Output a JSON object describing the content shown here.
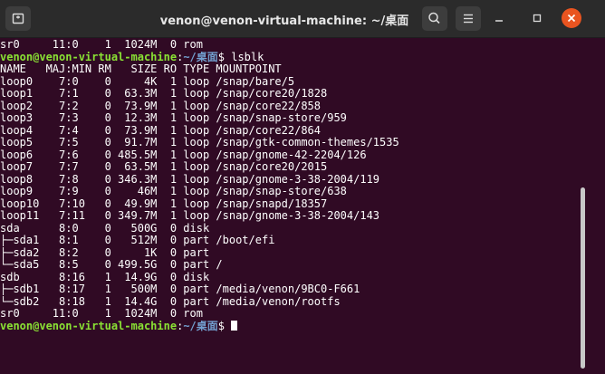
{
  "window": {
    "title": "venon@venon-virtual-machine: ~/桌面"
  },
  "colors": {
    "background": "#300a24",
    "titlebar": "#2b2b2b",
    "prompt_user": "#8ae234",
    "prompt_path": "#729fcf",
    "close_button": "#e95420"
  },
  "icons": {
    "new_tab": "new-tab-icon",
    "search": "search-icon",
    "menu": "hamburger-menu-icon",
    "minimize": "minimize-icon",
    "maximize": "maximize-icon",
    "close": "close-icon"
  },
  "terminal": {
    "top_line": "sr0     11:0    1  1024M  0 rom",
    "prompt": {
      "user_host": "venon@venon-virtual-machine",
      "colon": ":",
      "path": "~/桌面",
      "dollar": "$ ",
      "command": "lsblk"
    },
    "rows": [
      "NAME   MAJ:MIN RM   SIZE RO TYPE MOUNTPOINT",
      "loop0    7:0    0     4K  1 loop /snap/bare/5",
      "loop1    7:1    0  63.3M  1 loop /snap/core20/1828",
      "loop2    7:2    0  73.9M  1 loop /snap/core22/858",
      "loop3    7:3    0  12.3M  1 loop /snap/snap-store/959",
      "loop4    7:4    0  73.9M  1 loop /snap/core22/864",
      "loop5    7:5    0  91.7M  1 loop /snap/gtk-common-themes/1535",
      "loop6    7:6    0 485.5M  1 loop /snap/gnome-42-2204/126",
      "loop7    7:7    0  63.5M  1 loop /snap/core20/2015",
      "loop8    7:8    0 346.3M  1 loop /snap/gnome-3-38-2004/119",
      "loop9    7:9    0    46M  1 loop /snap/snap-store/638",
      "loop10   7:10   0  49.9M  1 loop /snap/snapd/18357",
      "loop11   7:11   0 349.7M  1 loop /snap/gnome-3-38-2004/143",
      "sda      8:0    0   500G  0 disk",
      "├─sda1   8:1    0   512M  0 part /boot/efi",
      "├─sda2   8:2    0     1K  0 part",
      "└─sda5   8:5    0 499.5G  0 part /",
      "sdb      8:16   1  14.9G  0 disk",
      "├─sdb1   8:17   1   500M  0 part /media/venon/9BC0-F661",
      "└─sdb2   8:18   1  14.4G  0 part /media/venon/rootfs",
      "sr0     11:0    1  1024M  0 rom"
    ],
    "bottom_prompt": {
      "user_host": "venon@venon-virtual-machine",
      "colon": ":",
      "path": "~/桌面",
      "dollar": "$ "
    }
  }
}
